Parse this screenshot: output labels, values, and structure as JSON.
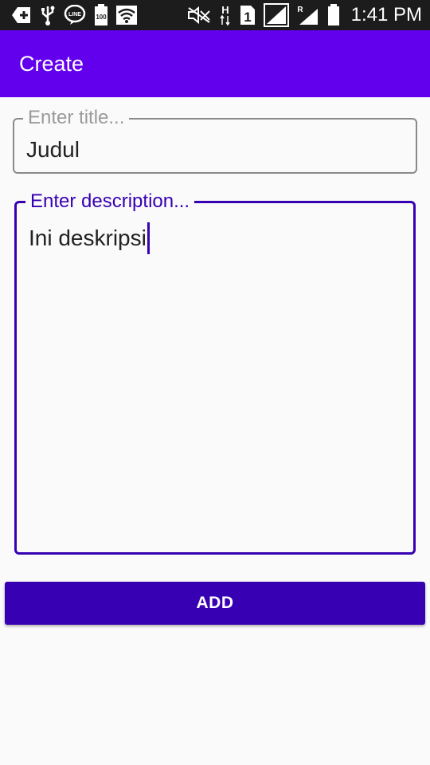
{
  "status_bar": {
    "time": "1:41 PM",
    "icons": [
      "add-box-icon",
      "usb-icon",
      "line-app-icon",
      "battery-100-icon",
      "wifi-icon",
      "mute-icon",
      "h-signal-icon",
      "sim-1-icon",
      "signal-strength-icon",
      "roaming-signal-icon",
      "battery-icon"
    ]
  },
  "app_bar": {
    "title": "Create",
    "color": "#6200ee"
  },
  "form": {
    "title_field": {
      "label": "Enter title...",
      "value": "Judul"
    },
    "description_field": {
      "label": "Enter description...",
      "value": "Ini deskripsi"
    },
    "add_button_label": "ADD"
  },
  "colors": {
    "primary": "#6200ee",
    "primary_dark": "#3700b3",
    "background": "#fafafa"
  }
}
